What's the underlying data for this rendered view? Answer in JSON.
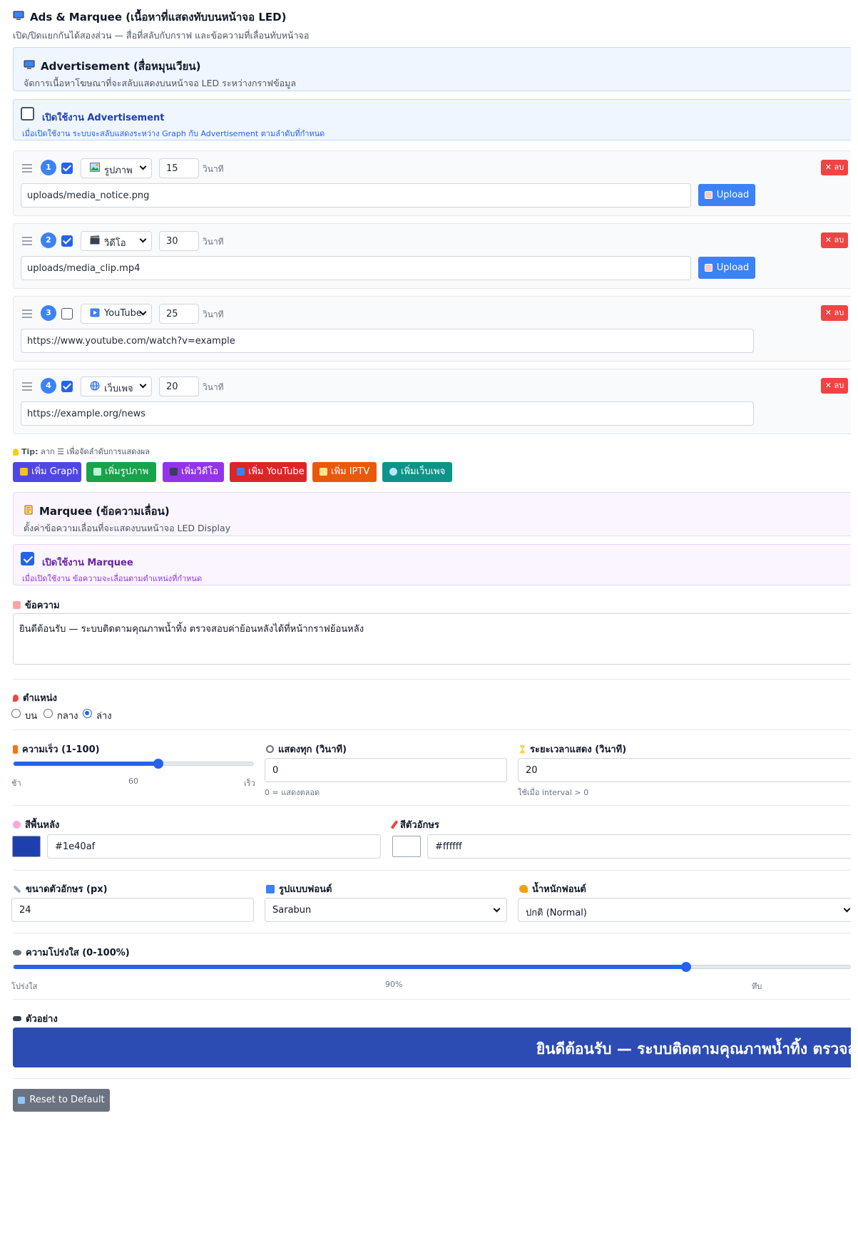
{
  "header": {
    "title": "Ads & Marquee (เนื้อหาที่แสดงทับบนหน้าจอ LED)",
    "subtitle": "เปิด/ปิดแยกกันได้สองส่วน — สื่อที่สลับกับกราฟ และข้อความที่เลื่อนทับหน้าจอ"
  },
  "ads": {
    "title": "Advertisement (สื่อหมุนเวียน)",
    "subtitle": "จัดการเนื้อหาโฆษณาที่จะสลับแสดงบนหน้าจอ LED ระหว่างกราฟข้อมูล",
    "enable_label": "เปิดใช้งาน Advertisement",
    "enable_desc": "เมื่อเปิดใช้งาน ระบบจะสลับแสดงระหว่าง Graph กับ Advertisement ตามลำดับที่กำหนด",
    "enabled": false,
    "items": [
      {
        "index": "1",
        "active": true,
        "type": "รูปภาพ",
        "icon": "picture-icon",
        "duration": "15",
        "unit": "วินาที",
        "url": "uploads/media_notice.png",
        "upload": true
      },
      {
        "index": "2",
        "active": true,
        "type": "วิดีโอ",
        "icon": "clapper-icon",
        "duration": "30",
        "unit": "วินาที",
        "url": "uploads/media_clip.mp4",
        "upload": true
      },
      {
        "index": "3",
        "active": false,
        "type": "YouTube",
        "icon": "play-icon",
        "duration": "25",
        "unit": "วินาที",
        "url": "https://www.youtube.com/watch?v=example",
        "upload": false
      },
      {
        "index": "4",
        "active": true,
        "type": "เว็บเพจ",
        "icon": "globe-icon",
        "duration": "20",
        "unit": "วินาที",
        "url": "https://example.org/news",
        "upload": false
      }
    ],
    "delete_label": "✕ ลบ",
    "upload_label": "Upload",
    "tip_prefix": "Tip:",
    "tip_text": " ลาก ☰ เพื่อจัดลำดับการแสดงผล",
    "add_buttons": [
      {
        "label": "เพิ่ม Graph",
        "color": "#4f46e5"
      },
      {
        "label": "เพิ่มรูปภาพ",
        "color": "#16a34a"
      },
      {
        "label": "เพิ่มวิดีโอ",
        "color": "#9333ea"
      },
      {
        "label": "เพิ่ม YouTube",
        "color": "#dc2626"
      },
      {
        "label": "เพิ่ม IPTV",
        "color": "#ea580c"
      },
      {
        "label": "เพิ่มเว็บเพจ",
        "color": "#0d9488"
      }
    ]
  },
  "marquee": {
    "title": "Marquee (ข้อความเลื่อน)",
    "subtitle": "ตั้งค่าข้อความเลื่อนที่จะแสดงบนหน้าจอ LED Display",
    "enable_label": "เปิดใช้งาน Marquee",
    "enable_desc": "เมื่อเปิดใช้งาน ข้อความจะเลื่อนตามตำแหน่งที่กำหนด",
    "enabled": true,
    "message_label": "ข้อความ",
    "message": "ยินดีต้อนรับ — ระบบติดตามคุณภาพน้ำทิ้ง ตรวจสอบค่าย้อนหลังได้ที่หน้ากราฟย้อนหลัง",
    "position_label": "ตำแหน่ง",
    "positions": [
      "บน",
      "กลาง",
      "ล่าง"
    ],
    "position_selected": "ล่าง",
    "speed_label": "ความเร็ว (1-100)",
    "speed_value": 60,
    "speed_value_text": "60",
    "speed_min_label": "ช้า",
    "speed_max_label": "เร็ว",
    "interval_label": "แสดงทุก (วินาที)",
    "interval_value": "0",
    "interval_hint": "0 = แสดงตลอด",
    "duration_label": "ระยะเวลาแสดง (วินาที)",
    "duration_value": "20",
    "duration_hint": "ใช้เมื่อ interval > 0",
    "bg_label": "สีพื้นหลัง",
    "bg_color": "#1e40af",
    "text_color_label": "สีตัวอักษร",
    "text_color": "#ffffff",
    "font_size_label": "ขนาดตัวอักษร (px)",
    "font_size_value": "24",
    "font_family_label": "รูปแบบฟอนต์",
    "font_family_value": "Sarabun",
    "font_weight_label": "น้ำหนักฟอนต์",
    "font_weight_value": "ปกติ (Normal)",
    "opacity_label": "ความโปร่งใส (0-100%)",
    "opacity_value": 90,
    "opacity_value_text": "90%",
    "opacity_min_label": "โปร่งใส",
    "opacity_max_label": "ทึบ",
    "preview_label": "ตัวอย่าง",
    "preview_text": "ยินดีต้อนรับ — ระบบติดตามคุณภาพน้ำทิ้ง ตรวจสอบค่าย้อนหลังได้ที่หน้ากราฟย้อนหลัง",
    "preview_bg": "#2c4cb4",
    "reset_label": "Reset to Default"
  }
}
